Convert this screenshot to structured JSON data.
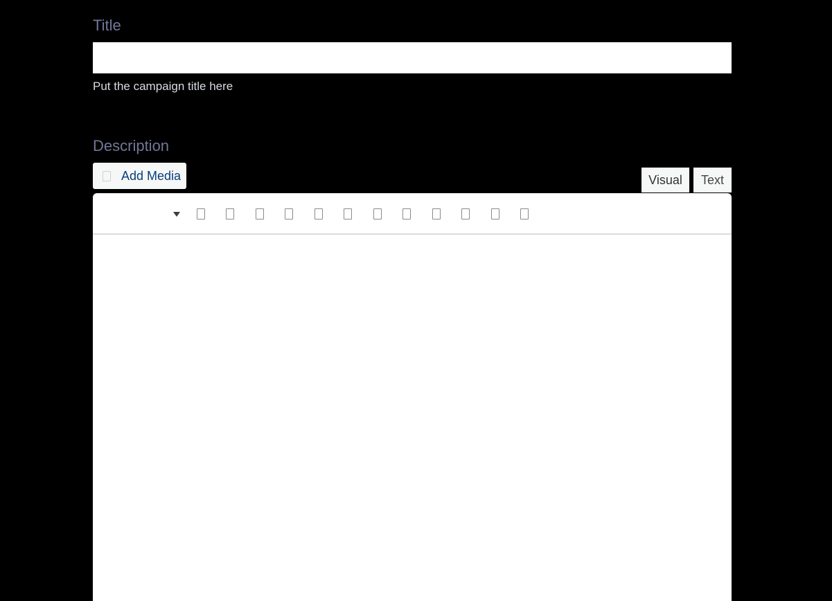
{
  "title_field": {
    "label": "Title",
    "value": "",
    "help": "Put the campaign title here"
  },
  "description_field": {
    "label": "Description"
  },
  "media": {
    "add_label": "Add Media",
    "icon": "media-icon"
  },
  "editor": {
    "tabs": [
      {
        "label": "Visual"
      },
      {
        "label": "Text"
      }
    ],
    "toolbar_buttons": [
      {
        "icon": "format-dropdown-icon"
      },
      {
        "icon": "bold-icon"
      },
      {
        "icon": "italic-icon"
      },
      {
        "icon": "bulleted-list-icon"
      },
      {
        "icon": "numbered-list-icon"
      },
      {
        "icon": "blockquote-icon"
      },
      {
        "icon": "align-left-icon"
      },
      {
        "icon": "align-center-icon"
      },
      {
        "icon": "align-right-icon"
      },
      {
        "icon": "insert-link-icon"
      },
      {
        "icon": "read-more-icon"
      },
      {
        "icon": "fullscreen-icon"
      },
      {
        "icon": "toolbar-toggle-icon"
      }
    ],
    "content": ""
  },
  "colors": {
    "background": "#000000",
    "label": "#72779a",
    "help_text": "#d8dbe4",
    "media_link": "#0a3e7a",
    "panel": "#f6f7f7"
  }
}
